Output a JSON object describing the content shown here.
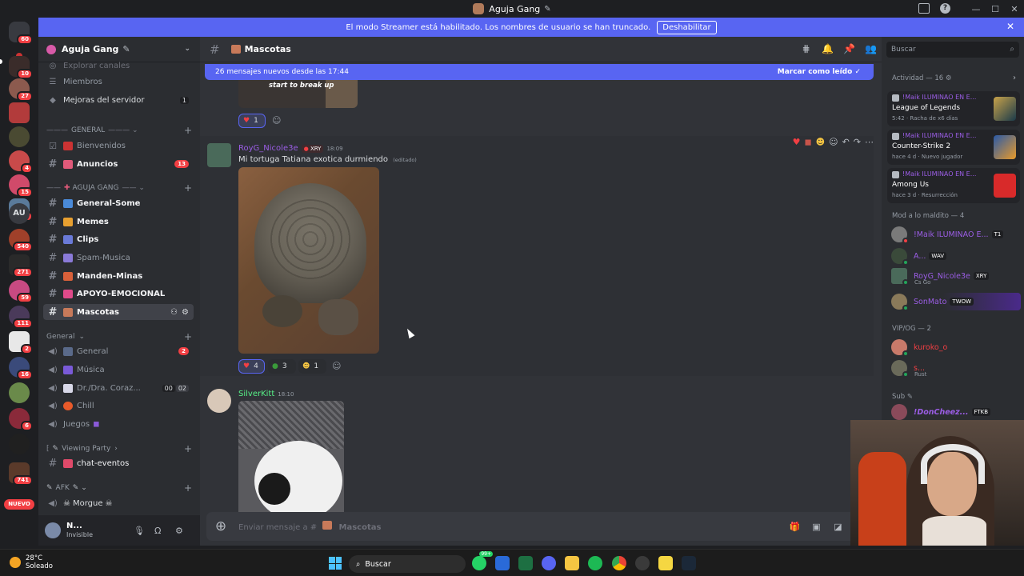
{
  "window": {
    "title": "Aguja Gang"
  },
  "banner": {
    "text": "El modo Streamer está habilitado. Los nombres de usuario se han truncado.",
    "button": "Deshabilitar"
  },
  "guilds": {
    "badges": [
      "60",
      "10",
      "27",
      "4",
      "15",
      "4",
      "540",
      "271",
      "59",
      "111",
      "2",
      "16",
      "6",
      "741"
    ],
    "au_label": "AU",
    "nuevo": "NUEVO"
  },
  "sidebar": {
    "server_name": "Aguja Gang",
    "explore": "Explorar canales",
    "members": "Miembros",
    "boosts": "Mejoras del servidor",
    "boosts_count": "1",
    "cat_general": "GENERAL",
    "cat_aguja": "AGUJA GANG",
    "cat_general2": "General",
    "cat_viewing": "Viewing Party",
    "cat_afk": "AFK",
    "channels": {
      "bienvenidos": "Bienvenidos",
      "anuncios": "Anuncios",
      "anuncios_badge": "13",
      "general_some": "General-Some",
      "memes": "Memes",
      "clips": "Clips",
      "spam": "Spam-Musica",
      "manden": "Manden-Minas",
      "apoyo": "APOYO-EMOCIONAL",
      "mascotas": "Mascotas",
      "v_general": "General",
      "v_general_badge": "2",
      "musica": "Música",
      "dr": "Dr./Dra. Coraz...",
      "dr_count_a": "00",
      "dr_count_b": "02",
      "chill": "Chill",
      "juegos": "Juegos",
      "chat_eventos": "chat-eventos",
      "morgue": "Morgue"
    },
    "user": {
      "name": "N...",
      "status": "Invisible"
    }
  },
  "chat": {
    "channel": "Mascotas",
    "new_bar": "26 mensajes nuevos desde las 17:44",
    "mark_read": "Marcar como leído",
    "prev_caption": "start to break up",
    "prev_react_count": "1",
    "msg1": {
      "author": "RoyG_Nicole3e",
      "tag": "XRY",
      "time": "18:09",
      "text": "Mi tortuga Tatiana exotica durmiendo",
      "edited": "(editado)",
      "reactions": [
        "4",
        "3",
        "1"
      ]
    },
    "msg2": {
      "author": "SilverKitt",
      "time": "18:10"
    },
    "composer_placeholder": "Enviar mensaje a #",
    "composer_channel": "Mascotas"
  },
  "members": {
    "search": "Buscar",
    "activity_header": "Actividad — 16",
    "activities": [
      {
        "who": "!Maik ILUMINAO EN E...",
        "game": "League of Legends",
        "meta": "5:42 · Racha de x6 días"
      },
      {
        "who": "!Maik ILUMINAO EN E...",
        "game": "Counter-Strike 2",
        "meta": "hace 4 d · Nuevo jugador"
      },
      {
        "who": "!Maik ILUMINAO EN E...",
        "game": "Among Us",
        "meta": "hace 3 d · Resurrección"
      }
    ],
    "mod_header": "Mod a lo maldito — 4",
    "mods": [
      {
        "name": "!Maik ILUMINAO E...",
        "tag": "T1"
      },
      {
        "name": "A...",
        "tag": "WAV"
      },
      {
        "name": "RoyG_Nicole3e",
        "tag": "XRY",
        "sub": "Cs Go"
      },
      {
        "name": "SonMato",
        "tag": "TWOW"
      }
    ],
    "vip_header": "VIP/OG — 2",
    "vips": [
      {
        "name": "kuroko_o"
      },
      {
        "name": "s...",
        "sub": "Rust"
      }
    ],
    "subs_header": "Sub",
    "subs": [
      {
        "name": "!DonCheez...",
        "tag": "FTKB"
      }
    ]
  },
  "taskbar": {
    "temp": "28°C",
    "weather": "Soleado",
    "search": "Buscar",
    "badge": "99+"
  }
}
